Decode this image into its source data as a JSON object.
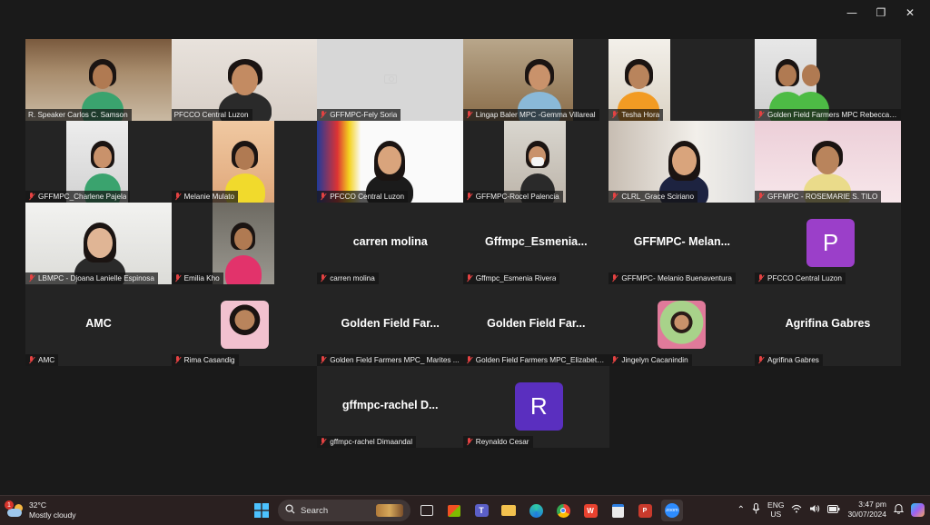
{
  "window_controls": {
    "minimize": "—",
    "restore": "❐",
    "close": "✕"
  },
  "participants": [
    {
      "name": "R. Speaker Carlos C. Samson",
      "muted": false,
      "video": true
    },
    {
      "name": "PFCCO Central Luzon",
      "muted": false,
      "video": true,
      "active_speaker": true
    },
    {
      "name": "GFFMPC-Fely Soria",
      "muted": true,
      "video": true,
      "camera_blocked": true
    },
    {
      "name": "Lingap Baler MPC -Gemma Villareal",
      "muted": true,
      "video": true
    },
    {
      "name": "Tesha Hora",
      "muted": true,
      "video": true
    },
    {
      "name": "Golden Field Farmers MPC Rebecca ...",
      "muted": true,
      "video": true
    },
    {
      "name": "GFFMPC_Charlene Pajela",
      "muted": true,
      "video": true
    },
    {
      "name": "Melanie Mulato",
      "muted": true,
      "video": true
    },
    {
      "name": "PFCCO Central Luzon",
      "muted": true,
      "video": true
    },
    {
      "name": "GFFMPC-Rocel Palencia",
      "muted": true,
      "video": true
    },
    {
      "name": "CLRL_Grace Sciriano",
      "muted": true,
      "video": true
    },
    {
      "name": "GFFMPC - ROSEMARIE S. TILO",
      "muted": true,
      "video": true
    },
    {
      "name": "LBMPC - Djoana Lanielle Espinosa",
      "muted": true,
      "video": true
    },
    {
      "name": "Emilia Kho",
      "muted": true,
      "video": true
    },
    {
      "name": "carren molina",
      "display": "carren molina",
      "muted": true,
      "video": false
    },
    {
      "name": "Gffmpc_Esmenia Rivera",
      "display": "Gffmpc_Esmenia...",
      "muted": true,
      "video": false
    },
    {
      "name": "GFFMPC- Melanio Buenaventura",
      "display": "GFFMPC-  Melan...",
      "muted": true,
      "video": false
    },
    {
      "name": "PFCCO Central Luzon",
      "letter": "P",
      "letter_color": "#9b3fc9",
      "muted": true,
      "video": false
    },
    {
      "name": "AMC",
      "display": "AMC",
      "muted": true,
      "video": false
    },
    {
      "name": "Rima Casandig",
      "muted": true,
      "video": false,
      "photo": true
    },
    {
      "name": "Golden Field Farmers MPC_ Marites ...",
      "display": "Golden  Field  Far...",
      "muted": true,
      "video": false
    },
    {
      "name": "Golden Field Farmers MPC_Elizabeth ...",
      "display": "Golden  Field  Far...",
      "muted": true,
      "video": false
    },
    {
      "name": "Jingelyn Cacanindin",
      "muted": true,
      "video": false,
      "photo": true
    },
    {
      "name": "Agrifina Gabres",
      "display": "Agrifina Gabres",
      "muted": true,
      "video": false
    },
    {
      "name": "gffmpc-rachel Dimaandal",
      "display": "gffmpc-rachel  D...",
      "muted": true,
      "video": false
    },
    {
      "name": "Reynaldo Cesar",
      "letter": "R",
      "letter_color": "#5a2fbf",
      "muted": true,
      "video": false
    }
  ],
  "taskbar": {
    "weather": {
      "temp": "32°C",
      "condition": "Mostly cloudy",
      "badge": "1"
    },
    "search_placeholder": "Search",
    "lang_line1": "ENG",
    "lang_line2": "US",
    "time": "3:47 pm",
    "date": "30/07/2024"
  }
}
